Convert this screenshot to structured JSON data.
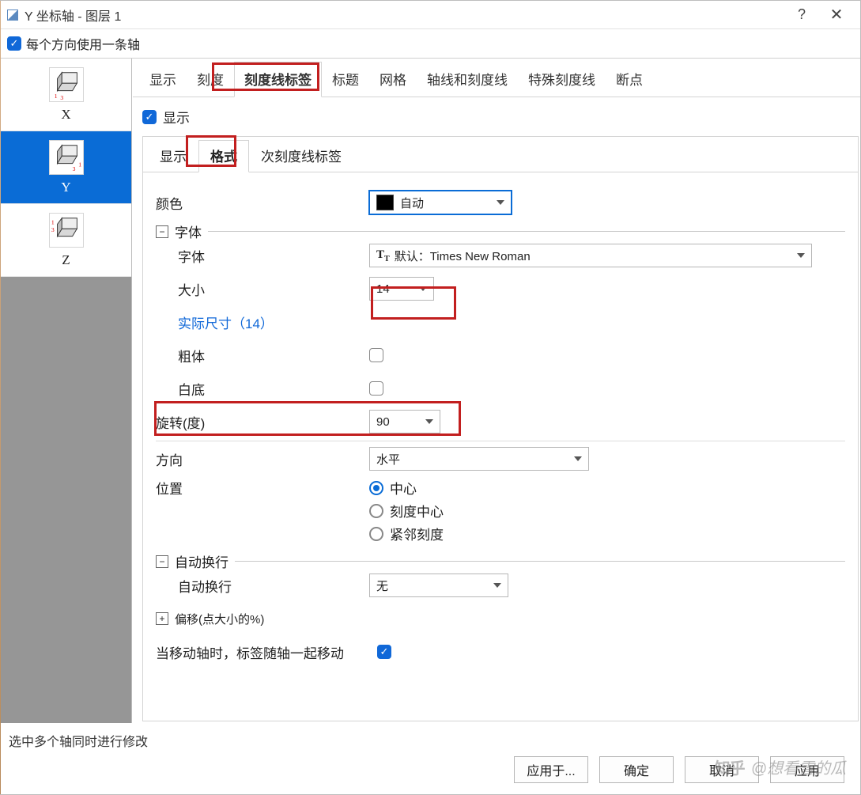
{
  "title": "Y 坐标轴 - 图层 1",
  "top_checkbox_label": "每个方向使用一条轴",
  "sidebar": {
    "items": [
      {
        "label": "X"
      },
      {
        "label": "Y"
      },
      {
        "label": "Z"
      }
    ]
  },
  "outer_tabs": [
    "显示",
    "刻度",
    "刻度线标签",
    "标题",
    "网格",
    "轴线和刻度线",
    "特殊刻度线",
    "断点"
  ],
  "outer_active_index": 2,
  "show_label": "显示",
  "inner_tabs": [
    "显示",
    "格式",
    "次刻度线标签"
  ],
  "inner_active_index": 1,
  "form": {
    "color_label": "颜色",
    "color_value": "自动",
    "font_group": "字体",
    "font_label": "字体",
    "font_value": "默认：Times New Roman",
    "size_label": "大小",
    "size_value": "14",
    "actual_label": "实际尺寸（14）",
    "bold_label": "粗体",
    "whitebg_label": "白底",
    "rotate_label": "旋转(度)",
    "rotate_value": "90",
    "direction_label": "方向",
    "direction_value": "水平",
    "position_label": "位置",
    "position_opts": [
      "中心",
      "刻度中心",
      "紧邻刻度"
    ],
    "wrap_group": "自动换行",
    "wrap_label": "自动换行",
    "wrap_value": "无",
    "offset_label": "偏移(点大小的%)",
    "movewith_label": "当移动轴时，标签随轴一起移动"
  },
  "footer_hint": "选中多个轴同时进行修改",
  "buttons": {
    "apply_to": "应用于...",
    "ok": "确定",
    "cancel": "取消",
    "apply": "应用"
  },
  "watermark": "@想看雪的瓜",
  "watermark_brand": "知乎"
}
